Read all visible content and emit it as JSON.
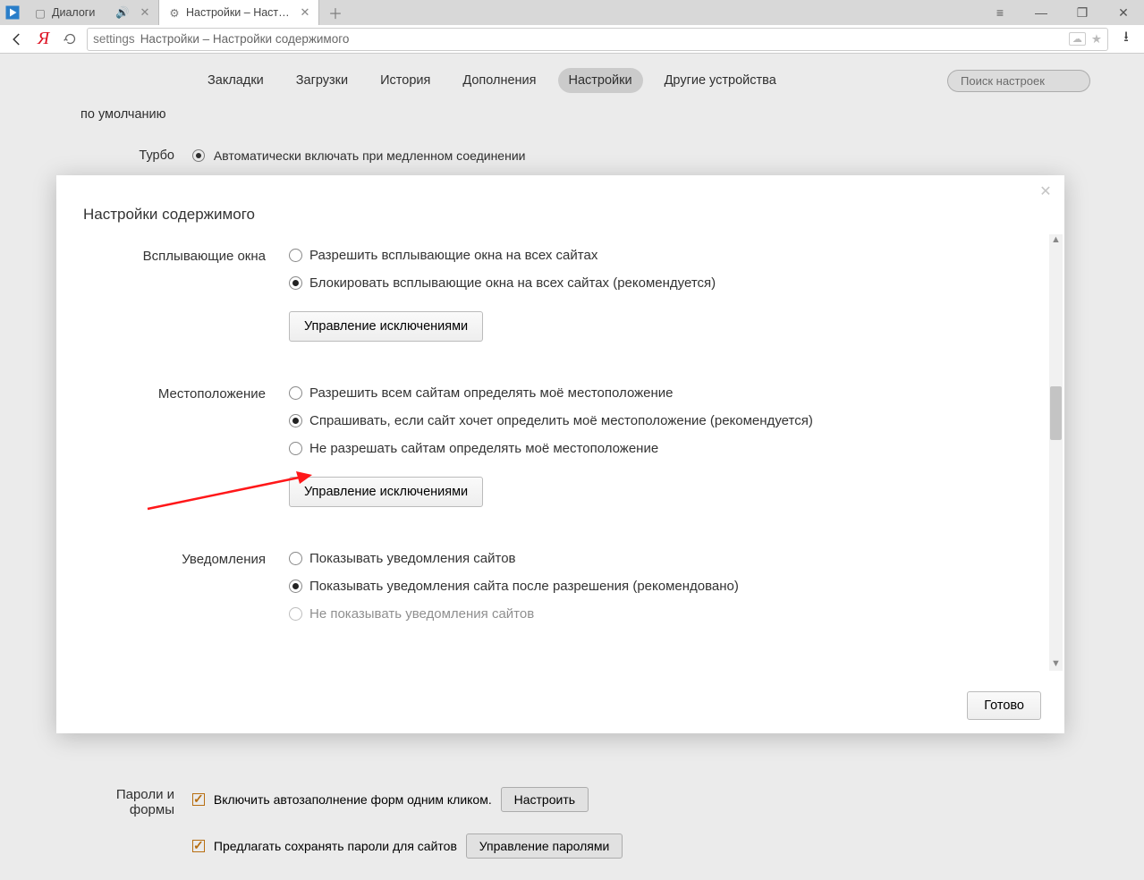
{
  "window": {
    "tabs": [
      {
        "title": "Диалоги",
        "active": false,
        "has_sound": true
      },
      {
        "title": "Настройки – Настройки",
        "active": true,
        "icon": "gear"
      }
    ]
  },
  "toolbar": {
    "url_host": "settings",
    "url_title": "Настройки – Настройки содержимого"
  },
  "settings_nav": {
    "items": [
      "Закладки",
      "Загрузки",
      "История",
      "Дополнения",
      "Настройки",
      "Другие устройства"
    ],
    "active_index": 4,
    "search_placeholder": "Поиск настроек"
  },
  "bg": {
    "default_label_tail": "по умолчанию",
    "turbo_label": "Турбо",
    "turbo_option": "Автоматически включать при медленном соединении",
    "passwords_heading": "Пароли и формы",
    "autofill_label": "Включить автозаполнение форм одним кликом.",
    "autofill_button": "Настроить",
    "save_pwd_label": "Предлагать сохранять пароли для сайтов",
    "save_pwd_button": "Управление паролями"
  },
  "modal": {
    "title": "Настройки содержимого",
    "sections": [
      {
        "label": "Всплывающие окна",
        "options": [
          "Разрешить всплывающие окна на всех сайтах",
          "Блокировать всплывающие окна на всех сайтах (рекомендуется)"
        ],
        "selected": 1,
        "manage_button": "Управление исключениями"
      },
      {
        "label": "Местоположение",
        "options": [
          "Разрешить всем сайтам определять моё местоположение",
          "Спрашивать, если сайт хочет определить моё местоположение (рекомендуется)",
          "Не разрешать сайтам определять моё местоположение"
        ],
        "selected": 1,
        "manage_button": "Управление исключениями"
      },
      {
        "label": "Уведомления",
        "options": [
          "Показывать уведомления сайтов",
          "Показывать уведомления сайта после разрешения (рекомендовано)",
          "Не показывать уведомления сайтов"
        ],
        "selected": 1
      }
    ],
    "done": "Готово"
  }
}
